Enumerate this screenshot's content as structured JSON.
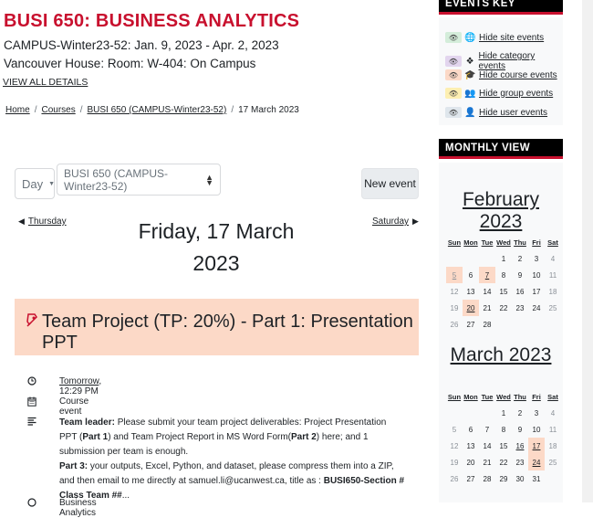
{
  "course": {
    "title": "BUSI 650: BUSINESS ANALYTICS",
    "line1": "CAMPUS-Winter23-52: Jan. 9, 2023 - Apr. 2, 2023",
    "line2": "Vancouver House: Room: W-404: On Campus",
    "view_all": "VIEW ALL DETAILS"
  },
  "breadcrumb": [
    "Home",
    "Courses",
    "BUSI 650 (CAMPUS-Winter23-52)",
    "17 March 2023"
  ],
  "controls": {
    "view_select": "Day",
    "course_select": "BUSI 650 (CAMPUS-Winter23-52)",
    "new_event": "New event"
  },
  "day_nav": {
    "prev": "Thursday",
    "next": "Saturday",
    "heading_line1": "Friday, 17 March",
    "heading_line2": "2023"
  },
  "event": {
    "title": "Team Project (TP: 20%) - Part 1: Presentation PPT",
    "time": "Tomorrow",
    "time_suffix": ", 12:29 PM",
    "type": "Course event",
    "desc_leader_label": "Team leader:",
    "desc_leader_text": " Please submit your team project deliverables: Project Presentation PPT (",
    "desc_part1": "Part 1",
    "desc_mid": ") and Team Project Report in MS Word Form(",
    "desc_part2": "Part 2",
    "desc_end": ")  here; and 1 submission per team is enough.",
    "desc_part3_label": "Part 3:",
    "desc_part3_text": " your outputs, Excel, Python, and dataset, please compress them into a ZIP, and then email to me directly at samuel.li@ucanwest.ca, title as : ",
    "desc_part3_bold": "BUSI650-Section # Class Team ##",
    "desc_ellipsis": "...",
    "bottom_text": "Business Analytics"
  },
  "events_key": {
    "header": "EVENTS KEY",
    "items": [
      {
        "label": "Hide site events",
        "color": "#d4edda"
      },
      {
        "label": "Hide category events",
        "color": "#e2d5ee"
      },
      {
        "label": "Hide course events",
        "color": "#fcd9c7"
      },
      {
        "label": "Hide group events",
        "color": "#fdefb2"
      },
      {
        "label": "Hide user events",
        "color": "#dfe6ec"
      }
    ]
  },
  "monthly": {
    "header": "MONTHLY VIEW",
    "day_headers": [
      "Sun",
      "Mon",
      "Tue",
      "Wed",
      "Thu",
      "Fri",
      "Sat"
    ],
    "february": {
      "title": "February 2023",
      "days": [
        "",
        "",
        "",
        "1",
        "2",
        "3",
        "4",
        "5",
        "6",
        "7",
        "8",
        "9",
        "10",
        "11",
        "12",
        "13",
        "14",
        "15",
        "16",
        "17",
        "18",
        "19",
        "20",
        "21",
        "22",
        "23",
        "24",
        "25",
        "26",
        "27",
        "28",
        "",
        "",
        "",
        ""
      ],
      "event_days": [
        "5",
        "7",
        "20"
      ]
    },
    "march": {
      "title": "March 2023",
      "days": [
        "",
        "",
        "",
        "1",
        "2",
        "3",
        "4",
        "5",
        "6",
        "7",
        "8",
        "9",
        "10",
        "11",
        "12",
        "13",
        "14",
        "15",
        "16",
        "17",
        "18",
        "19",
        "20",
        "21",
        "22",
        "23",
        "24",
        "25",
        "26",
        "27",
        "28",
        "29",
        "30",
        "31",
        ""
      ],
      "event_days": [
        "17",
        "24"
      ],
      "underlined_days": [
        "16"
      ]
    }
  }
}
